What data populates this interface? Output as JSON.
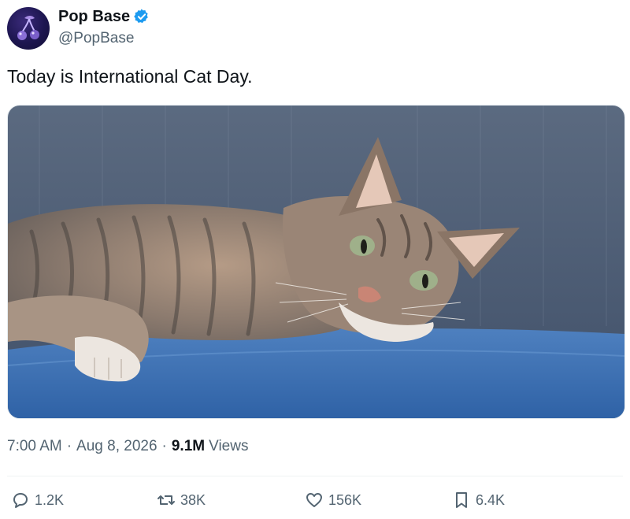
{
  "account": {
    "display_name": "Pop Base",
    "handle": "@PopBase",
    "verified": true,
    "verified_color": "#1d9bf0"
  },
  "tweet": {
    "text": "Today is International Cat Day.",
    "time": "7:00 AM",
    "date": "Aug 8, 2026",
    "separator": "·",
    "views_count": "9.1M",
    "views_label": "Views"
  },
  "media": {
    "icon": "photo-of-cat"
  },
  "actions": {
    "reply": {
      "icon": "reply-icon",
      "count": "1.2K"
    },
    "repost": {
      "icon": "repost-icon",
      "count": "38K"
    },
    "like": {
      "icon": "heart-icon",
      "count": "156K"
    },
    "bookmark": {
      "icon": "bookmark-icon",
      "count": "6.4K"
    }
  }
}
